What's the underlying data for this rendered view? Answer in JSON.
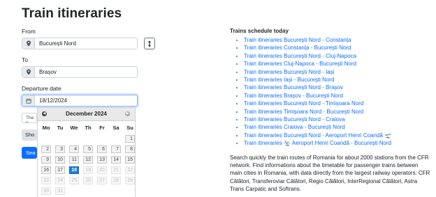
{
  "page": {
    "title": "Train itineraries"
  },
  "form": {
    "from_label": "From",
    "from_value": "București Nord",
    "from_icon": "map-pin-icon",
    "swap_icon": "swap-vertical-icon",
    "to_label": "To",
    "to_value": "Brașov",
    "to_icon": "map-pin-icon",
    "date_label": "Departure date",
    "date_value": "18/12/2024",
    "date_icon": "calendar-icon",
    "partial_field_text": "The p",
    "show_button_label": "Sho",
    "search_button_label": "Sea"
  },
  "calendar": {
    "month_label": "December 2024",
    "prev_icon": "chevron-left-icon",
    "next_icon": "chevron-right-icon",
    "weekdays": [
      "Mo",
      "Tu",
      "We",
      "Th",
      "Fr",
      "Sa",
      "Su"
    ],
    "weeks": [
      [
        "",
        "",
        "",
        "",
        "",
        "",
        "1"
      ],
      [
        "2",
        "3",
        "4",
        "5",
        "6",
        "7",
        "8"
      ],
      [
        "9",
        "10",
        "11",
        "12",
        "13",
        "14",
        "15"
      ],
      [
        "16",
        "17",
        "18",
        "19",
        "20",
        "21",
        "22"
      ],
      [
        "23",
        "24",
        "25",
        "26",
        "27",
        "28",
        "29"
      ],
      [
        "30",
        "31",
        "",
        "",
        "",
        "",
        ""
      ]
    ],
    "selected_day": "18",
    "last_enabled_day": 18
  },
  "schedule": {
    "title": "Trains schedule today",
    "links": [
      "Train itineraries București Nord - Constanța",
      "Train itineraries Constanța - București Nord",
      "Train itineraries București Nord - Cluj-Napoca",
      "Train itineraries Cluj-Napoca - București Nord",
      "Train itineraries București Nord - Iași",
      "Train itineraries Iași - București Nord",
      "Train itineraries București Nord - Brașov",
      "Train itineraries Brașov - București Nord",
      "Train itineraries București Nord - Timișoara Nord",
      "Train itineraries Timișoara Nord - București Nord",
      "Train itineraries București Nord - Craiova",
      "Train itineraries Craiova - București Nord",
      "Train itineraries București Nord - Aeroport Henri Coandă 🛫",
      "Train itineraries 🛬 Aeroport Henri Coandă - București Nord"
    ],
    "description": "Search quickly the train routes of Romania for about 2000 stations from the CFR network. Find informations about the timetable for passenger trains between main cities in Romania, with data directly from the largest railway operators: CFR Călători, Transferoviar Călători, Regio Călători, InterRegional Călători, Astra Trans Carpatic and Softrans."
  },
  "colors": {
    "link": "#0d6efd",
    "primary": "#0d6efd",
    "selected_day": "#1c7ed6"
  }
}
